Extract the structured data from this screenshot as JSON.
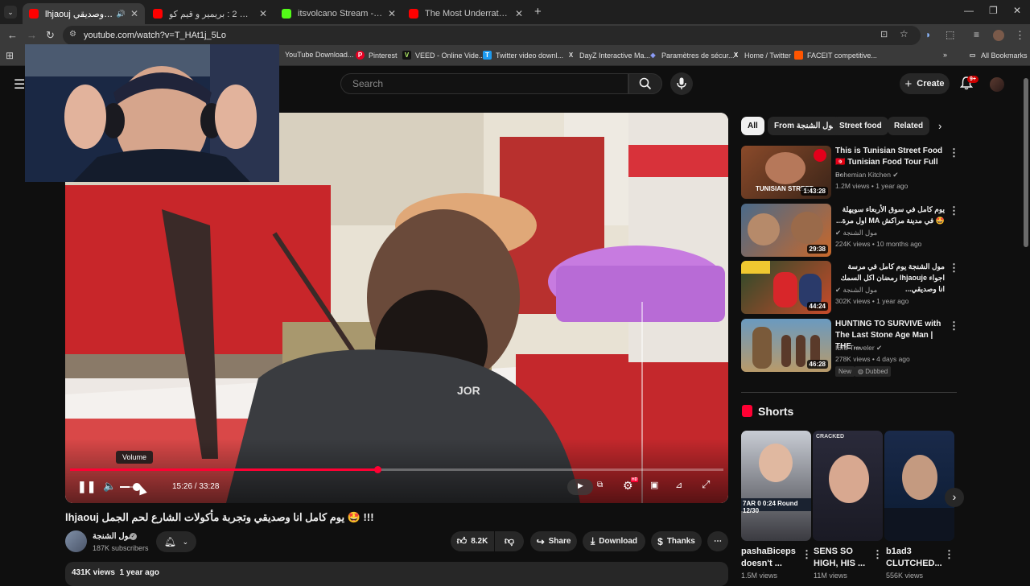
{
  "browser": {
    "tabs": [
      {
        "title": "lhjaouj يوم كامل انا وصديقي",
        "active": true,
        "favicon_color": "#ff0000",
        "audio": "🔊"
      },
      {
        "title": "كاونتر سترايك 2 : بريمير و قيم كو",
        "active": false,
        "favicon_color": "#ff0000"
      },
      {
        "title": "itsvolcano Stream - Watch Live",
        "active": false,
        "favicon_color": "#53fc18"
      },
      {
        "title": "The Most Underrated Food in t",
        "active": false,
        "favicon_color": "#ff0000"
      }
    ],
    "new_tab": "+",
    "url": "youtube.com/watch?v=T_HAt1j_5Lo",
    "bookmarks": [
      {
        "label": "YouTube Download...",
        "color": "#3a3a3a",
        "glyph": ""
      },
      {
        "label": "Pinterest",
        "color": "#e60023",
        "glyph": "P"
      },
      {
        "label": "VEED - Online Vide...",
        "color": "#111111",
        "glyph": "V"
      },
      {
        "label": "Twitter video downl...",
        "color": "#1d9bf0",
        "glyph": "T"
      },
      {
        "label": "DayZ Interactive Ma...",
        "color": "#333333",
        "glyph": "X"
      },
      {
        "label": "Paramètres de sécur...",
        "color": "#6b7bff",
        "glyph": "◈"
      },
      {
        "label": "Home / Twitter",
        "color": "#000000",
        "glyph": "X"
      },
      {
        "label": "FACEIT competitive...",
        "color": "#ff5500",
        "glyph": "▰"
      }
    ],
    "all_bookmarks": "All Bookmarks"
  },
  "youtube": {
    "search_placeholder": "Search",
    "create_label": "Create",
    "notif_badge": "9+"
  },
  "player": {
    "time": "15:26 / 33:28",
    "volume_tooltip": "Volume",
    "progress_fraction": 0.47,
    "volume_fraction": 0.55,
    "hd_badge": "HD"
  },
  "video": {
    "title": "lhjaouj يوم كامل انا وصديقي وتجربة مأكولات الشارع لحم الجمل 🤩 !!!",
    "channel": "مول الشنجة",
    "subscribers": "187K subscribers",
    "likes": "8.2K",
    "share_label": "Share",
    "download_label": "Download",
    "thanks_label": "Thanks",
    "views_date": "431K views  1 year ago"
  },
  "filters": [
    {
      "label": "All",
      "selected": true
    },
    {
      "label": "From مول الشنجة",
      "selected": false
    },
    {
      "label": "Street food",
      "selected": false
    },
    {
      "label": "Related",
      "selected": false
    }
  ],
  "recommendations": [
    {
      "title": "This is Tunisian Street Food 🇹🇳 Tunisian Food Tour Full ...",
      "channel": "Bohemian Kitchen",
      "meta": "1.2M views • 1 year ago",
      "duration": "1:43:28",
      "thumb_text": "TUNISIAN STREET",
      "verified": true
    },
    {
      "title": "يوم كامل في سوق الأربعاء سويهلة 🤩 في مدينة مراكش MA اول مرة...",
      "channel": "مول الشنجة",
      "meta": "224K views • 10 months ago",
      "duration": "29:38",
      "thumb_text": "",
      "verified": true
    },
    {
      "title": "مول الشنجة يوم كامل في مرسة اجواء lhjaouje رمضان اكل السمك انا وصديقي...",
      "channel": "مول الشنجة",
      "meta": "302K views • 1 year ago",
      "duration": "44:24",
      "thumb_text": "",
      "verified": true
    },
    {
      "title": "HUNTING TO SURVIVE with The Last Stone Age Man | THE ...",
      "channel": "IBra Traveler",
      "meta": "278K views • 4 days ago",
      "duration": "46:28",
      "thumb_text": "",
      "verified": true,
      "badges": [
        "New",
        "Dubbed"
      ]
    }
  ],
  "shorts": {
    "heading": "Shorts",
    "items": [
      {
        "title": "pashaBiceps doesn't ...",
        "views": "1.5M views"
      },
      {
        "title": "SENS SO HIGH, HIS ...",
        "views": "11M views"
      },
      {
        "title": "b1ad3 CLUTCHED...",
        "views": "556K views"
      }
    ],
    "thumb_texts": [
      "7AR  0  0:24  Round 12/30",
      "CRACKED",
      ""
    ]
  }
}
